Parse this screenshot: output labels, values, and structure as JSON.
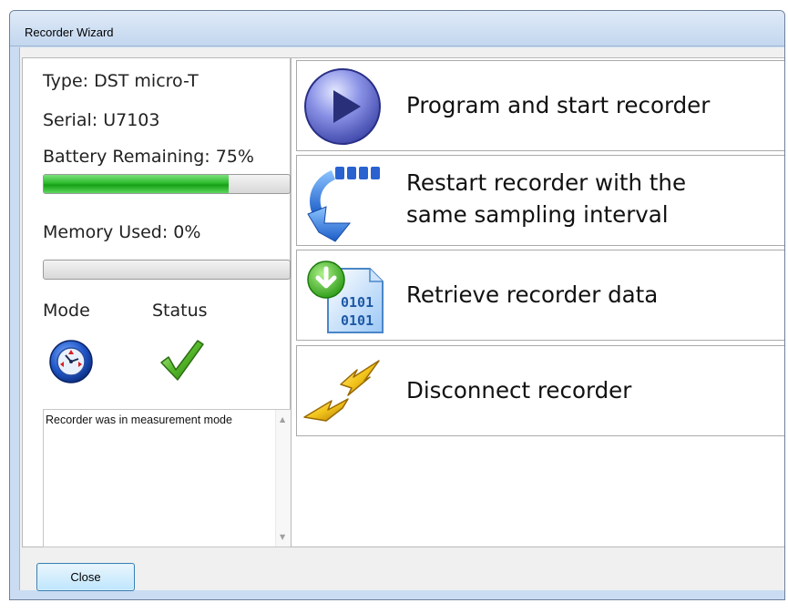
{
  "window": {
    "title": "Recorder Wizard"
  },
  "info": {
    "type_label": "Type: DST micro-T",
    "serial_label": "Serial: U7103",
    "battery_label": "Battery Remaining: 75%",
    "battery_level": 0.75,
    "memory_label": "Memory Used: 0%",
    "memory_level": 0.0,
    "mode_label": "Mode",
    "status_label": "Status"
  },
  "message": {
    "text": "Recorder was in measurement mode"
  },
  "actions": [
    {
      "label": "Program and start recorder",
      "icon": "play-icon"
    },
    {
      "label_line1": "Restart recorder with the",
      "label_line2": "same sampling interval",
      "icon": "restart-arrow-icon"
    },
    {
      "label": "Retrieve recorder data",
      "icon": "retrieve-data-icon"
    },
    {
      "label": "Disconnect recorder",
      "icon": "disconnect-plug-icon"
    }
  ],
  "footer": {
    "close_label": "Close"
  },
  "colors": {
    "progress_fill": "#2dbb2d",
    "accent_blue": "#1a4fa8",
    "status_check": "#2e9e1a"
  }
}
